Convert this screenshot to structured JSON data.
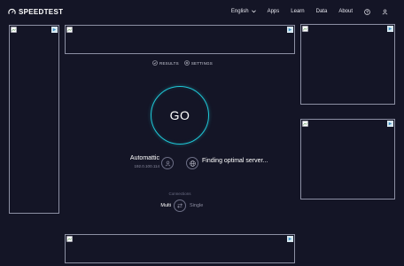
{
  "header": {
    "logo_text": "SPEEDTEST",
    "nav": {
      "language": "English",
      "apps": "Apps",
      "learn": "Learn",
      "data": "Data",
      "about": "About"
    }
  },
  "links": {
    "results": "RESULTS",
    "settings": "SETTINGS"
  },
  "go_button": {
    "label": "GO"
  },
  "provider": {
    "name": "Automattic",
    "ip": "192.0.100.114"
  },
  "server": {
    "status": "Finding optimal server..."
  },
  "connections": {
    "label": "Connections",
    "multi": "Multi",
    "single": "Single"
  },
  "colors": {
    "background": "#141526",
    "accent": "#1fc8d7",
    "muted_text": "#8b8ca0"
  }
}
